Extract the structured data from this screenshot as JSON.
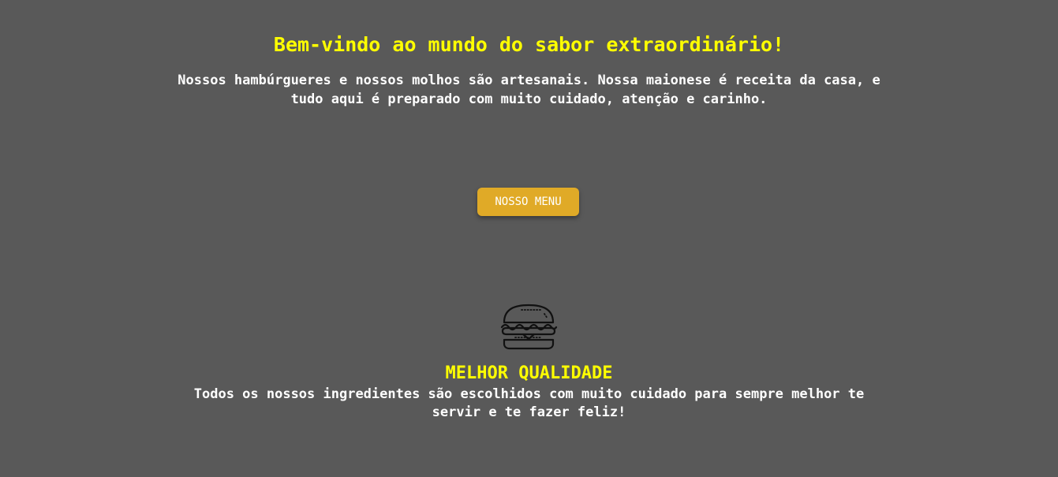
{
  "hero": {
    "title": "Bem-vindo ao mundo do sabor extraordinário!",
    "description": "Nossos hambúrgueres e nossos molhos são artesanais. Nossa maionese é receita da casa, e tudo aqui é preparado com muito cuidado, atenção e carinho.",
    "menu_button_label": "NOSSO MENU"
  },
  "feature": {
    "icon": "burger-icon",
    "title": "MELHOR QUALIDADE",
    "text": "Todos os nossos ingredientes são escolhidos com muito cuidado para sempre melhor te servir e te fazer feliz!"
  },
  "colors": {
    "background": "#595959",
    "accent_text": "#ffff00",
    "button": "#e0aa27",
    "body_text": "#ffffff"
  }
}
